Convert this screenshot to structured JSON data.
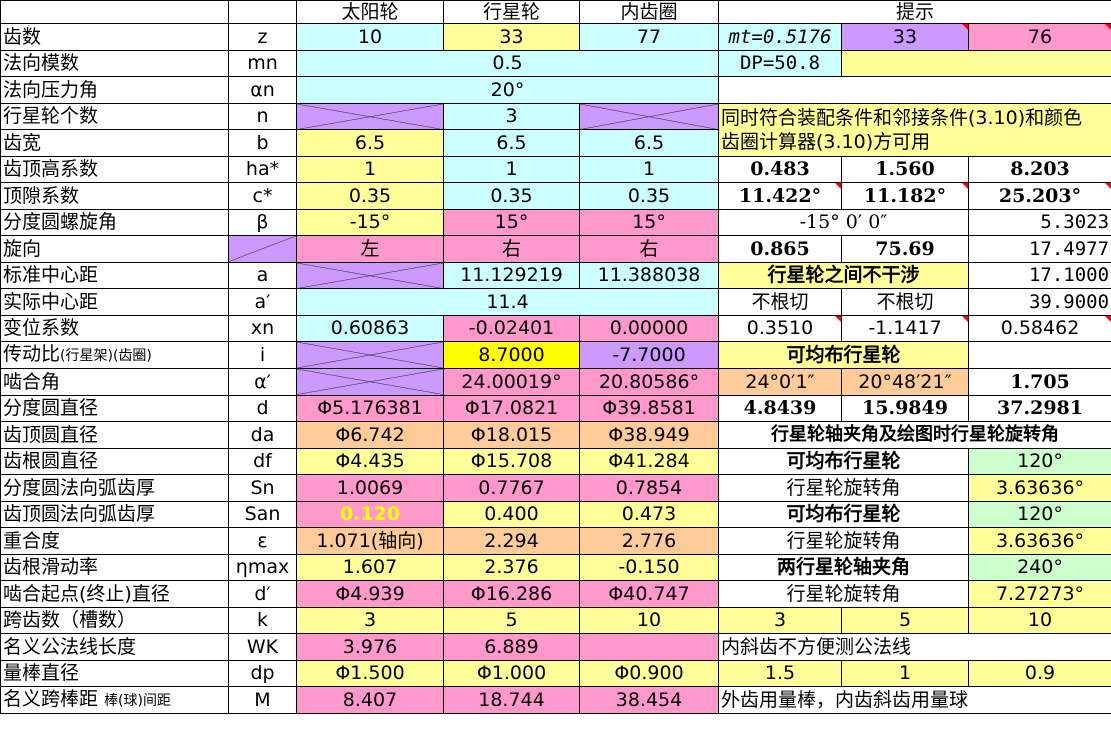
{
  "header": {
    "sun": "太阳轮",
    "planet": "行星轮",
    "ring": "内齿圈",
    "hint": "提示"
  },
  "rows": {
    "z": {
      "label": "齿数",
      "sym": "z",
      "sun": "10",
      "planet": "33",
      "ring": "77",
      "h1": "mt=0.5176",
      "h2": "33",
      "h3": "76"
    },
    "mn": {
      "label": "法向模数",
      "sym": "mn",
      "value": "0.5",
      "h1": "DP=50.8"
    },
    "an": {
      "label": "法向压力角",
      "sym": "αn",
      "value": "20°"
    },
    "n": {
      "label": "行星轮个数",
      "sym": "n",
      "value": "3",
      "note1": "同时符合装配条件和邻接条件(3.10)和颜色",
      "note2": "齿圈计算器(3.10)方可用"
    },
    "b": {
      "label": "齿宽",
      "sym": "b",
      "sun": "6.5",
      "planet": "6.5",
      "ring": "6.5"
    },
    "ha": {
      "label": "齿顶高系数",
      "sym": "ha*",
      "sun": "1",
      "planet": "1",
      "ring": "1",
      "h1": "0.483",
      "h2": "1.560",
      "h3": "8.203"
    },
    "c": {
      "label": "顶隙系数",
      "sym": "c*",
      "sun": "0.35",
      "planet": "0.35",
      "ring": "0.35",
      "h1": "11.422°",
      "h2": "11.182°",
      "h3": "25.203°"
    },
    "beta": {
      "label": "分度圆螺旋角",
      "sym": "β",
      "sun": "-15°",
      "planet": "15°",
      "ring": "15°",
      "h12": "-15° 0′ 0″",
      "h3": "5.3023"
    },
    "dir": {
      "label": "旋向",
      "sym": "",
      "sun": "左",
      "planet": "右",
      "ring": "右",
      "h1": "0.865",
      "h2": "75.69",
      "h3": "17.4977"
    },
    "a": {
      "label": "标准中心距",
      "sym": "a",
      "planet": "11.129219",
      "ring": "11.388038",
      "h12": "行星轮之间不干涉",
      "h3": "17.1000"
    },
    "a2": {
      "label": "实际中心距",
      "sym": "a′",
      "value": "11.4",
      "h1": "不根切",
      "h2": "不根切",
      "h3": "39.9000"
    },
    "xn": {
      "label": "变位系数",
      "sym": "xn",
      "sun": "0.60863",
      "planet": "-0.02401",
      "ring": "0.00000",
      "h1": "0.3510",
      "h2": "-1.1417",
      "h3": "0.58462"
    },
    "i": {
      "label": "传动比",
      "label_sm": "(行星架)(齿圈)",
      "sym": "i",
      "planet": "8.7000",
      "ring": "-7.7000",
      "h12": "可均布行星轮"
    },
    "alpha": {
      "label": "啮合角",
      "sym": "α′",
      "planet": "24.00019°",
      "ring": "20.80586°",
      "h1": "24°0′1″",
      "h2": "20°48′21″",
      "h3": "1.705"
    },
    "d": {
      "label": "分度圆直径",
      "sym": "d",
      "sun": "Φ5.176381",
      "planet": "Φ17.0821",
      "ring": "Φ39.8581",
      "h1": "4.8439",
      "h2": "15.9849",
      "h3": "37.2981"
    },
    "da": {
      "label": "齿顶圆直径",
      "sym": "da",
      "sun": "Φ6.742",
      "planet": "Φ18.015",
      "ring": "Φ38.949",
      "h123": "行星轮轴夹角及绘图时行星轮旋转角"
    },
    "df": {
      "label": "齿根圆直径",
      "sym": "df",
      "sun": "Φ4.435",
      "planet": "Φ15.708",
      "ring": "Φ41.284",
      "h12": "可均布行星轮",
      "h3": "120°"
    },
    "sn": {
      "label": "分度圆法向弧齿厚",
      "sym": "Sn",
      "sun": "1.0069",
      "planet": "0.7767",
      "ring": "0.7854",
      "h12": "行星轮旋转角",
      "h3": "3.63636°"
    },
    "san": {
      "label": "齿顶圆法向弧齿厚",
      "sym": "San",
      "sun": "0.120",
      "planet": "0.400",
      "ring": "0.473",
      "h12": "可均布行星轮",
      "h3": "120°"
    },
    "eps": {
      "label": "重合度",
      "sym": "ε",
      "sun": "1.071(轴向)",
      "planet": "2.294",
      "ring": "2.776",
      "h12": "行星轮旋转角",
      "h3": "3.63636°"
    },
    "eta": {
      "label": "齿根滑动率",
      "sym": "ηmax",
      "sun": "1.607",
      "planet": "2.376",
      "ring": "-0.150",
      "h12": "两行星轮轴夹角",
      "h3": "240°"
    },
    "dd": {
      "label": "啮合起点(终止)直径",
      "sym": "d′",
      "sun": "Φ4.939",
      "planet": "Φ16.286",
      "ring": "Φ40.747",
      "h12": "行星轮旋转角",
      "h3": "7.27273°"
    },
    "k": {
      "label": "跨齿数（槽数）",
      "sym": "k",
      "sun": "3",
      "planet": "5",
      "ring": "10",
      "h1": "3",
      "h2": "5",
      "h3": "10"
    },
    "wk": {
      "label": "名义公法线长度",
      "sym": "WK",
      "sun": "3.976",
      "planet": "6.889",
      "ring": "",
      "h123": "内斜齿不方便测公法线"
    },
    "dp": {
      "label": "量棒直径",
      "sym": "dp",
      "sun": "Φ1.500",
      "planet": "Φ1.000",
      "ring": "Φ0.900",
      "h1": "1.5",
      "h2": "1",
      "h3": "0.9"
    },
    "m": {
      "label": "名义跨棒距",
      "label_sm": "棒(球)间距",
      "sym": "M",
      "sun": "8.407",
      "planet": "18.744",
      "ring": "38.454",
      "h123": "外齿用量棒，内齿斜齿用量球"
    }
  },
  "colors": {
    "cyan": "#ccffff",
    "yellow": "#ffff99",
    "pink": "#ff99cc",
    "purple": "#cc99ff",
    "orange": "#ffcc99",
    "green": "#ccffcc",
    "bright_yellow": "#ffff00",
    "blue_text": "#0000ff",
    "red_text": "#ff0000",
    "green_text": "#006600"
  }
}
